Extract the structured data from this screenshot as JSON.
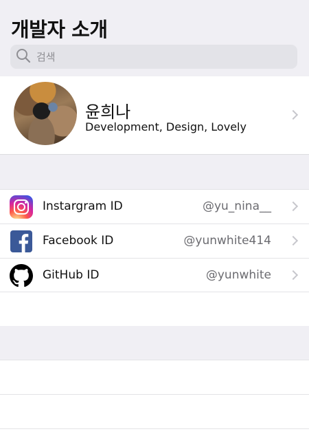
{
  "header": {
    "title": "개발자 소개"
  },
  "search": {
    "placeholder": "검색",
    "icon": "search-icon"
  },
  "profile": {
    "name": "윤희나",
    "description": "Development, Design, Lovely",
    "avatar": "profile-photo"
  },
  "accounts": [
    {
      "icon": "instagram-icon",
      "label": "Instargram ID",
      "value": "@yu_nina__"
    },
    {
      "icon": "facebook-icon",
      "label": "Facebook ID",
      "value": "@yunwhite414"
    },
    {
      "icon": "github-icon",
      "label": "GitHub ID",
      "value": "@yunwhite"
    }
  ],
  "colors": {
    "background": "#f0eff4",
    "cell": "#ffffff",
    "search_field": "#e3e3e8",
    "secondary_text": "#6b6b70",
    "chevron": "#c7c7cc",
    "facebook": "#3b5998"
  }
}
